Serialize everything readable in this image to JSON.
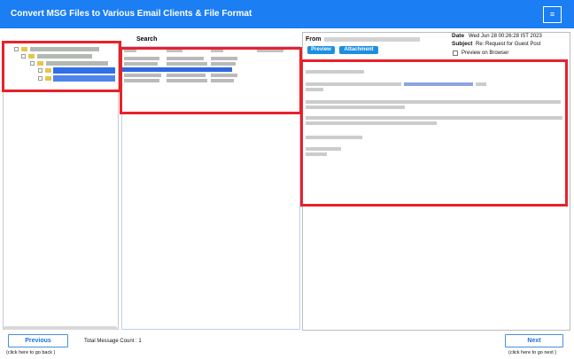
{
  "header": {
    "title": "Convert MSG Files to Various Email Clients & File Format",
    "menu_glyph": "≡"
  },
  "message_list": {
    "search_label": "Search"
  },
  "viewer": {
    "from_label": "From",
    "preview_button": "Preview",
    "attachment_button": "Attachment",
    "date_label": "Date",
    "date_value": "Wed Jun 28 00:26:28 IST 2023",
    "subject_label": "Subject",
    "subject_value": "Re: Request for Guest Post",
    "preview_on_browser_label": "Preview on Browser"
  },
  "footer": {
    "previous_label": "Previous",
    "previous_hint": "(click here to  go back )",
    "total_count_text": "Total Message Count : 1",
    "next_label": "Next",
    "next_hint": "(click here to  go next )"
  },
  "colors": {
    "header_blue": "#1b7ef2",
    "highlight_red": "#e8212b",
    "selection_blue": "#2f69dd",
    "button_blue": "#1d8fe0"
  }
}
